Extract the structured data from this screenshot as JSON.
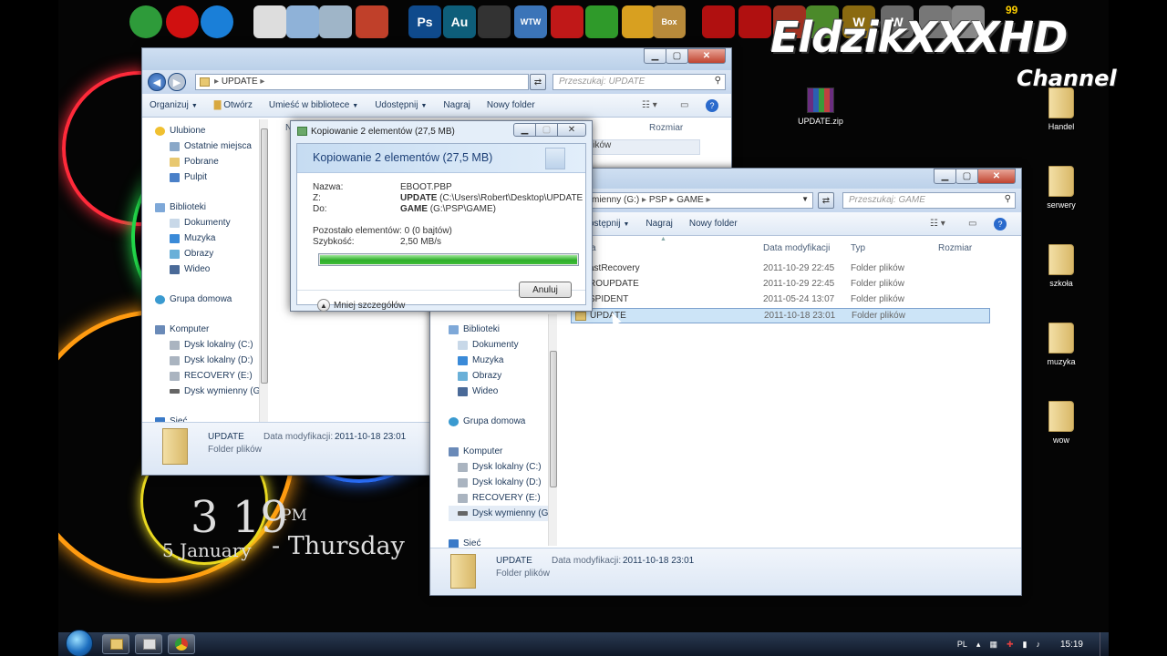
{
  "desktop": {
    "watermark_main": "EldzikXXXHD",
    "watermark_sub": "Channel",
    "clock": {
      "time": "3 19",
      "ampm": "PM",
      "date": "5 January",
      "day": "- Thursday"
    },
    "top_icons": [
      {
        "name": "chrome-icon",
        "color": "#2e9b3a"
      },
      {
        "name": "opera-icon",
        "color": "#d01010"
      },
      {
        "name": "ie-icon",
        "color": "#1a7fd8"
      },
      {
        "name": "document-icon",
        "color": "#dddddd"
      },
      {
        "name": "folder-icon",
        "color": "#8fb2d8"
      },
      {
        "name": "recycle-bin-icon",
        "color": "#9fb5c8"
      },
      {
        "name": "media-icon",
        "color": "#c0402a"
      },
      {
        "name": "photoshop-icon",
        "color": "#0f4a8c",
        "label": "Ps"
      },
      {
        "name": "audition-icon",
        "color": "#0e5e7a",
        "label": "Au"
      },
      {
        "name": "monitor-icon",
        "color": "#333333"
      },
      {
        "name": "wtw-icon",
        "color": "#3b74b8",
        "label": "WTW"
      },
      {
        "name": "game-icon",
        "color": "#c01818"
      },
      {
        "name": "utorrent-icon",
        "color": "#2f9a2a"
      },
      {
        "name": "windows-flag-icon",
        "color": "#d8a020"
      },
      {
        "name": "hamster-box-icon",
        "color": "#b88a3a",
        "label": "Box"
      },
      {
        "name": "racing-icon",
        "color": "#b01010"
      },
      {
        "name": "racing-2-icon",
        "color": "#b01010"
      },
      {
        "name": "game-3-icon",
        "color": "#a03020"
      },
      {
        "name": "minecraft-icon",
        "color": "#4b8a2a"
      },
      {
        "name": "warcraft-icon",
        "color": "#8a6a10",
        "label": "W"
      },
      {
        "name": "warcraft-2-icon",
        "color": "#6a6a6a",
        "label": "W"
      },
      {
        "name": "steam-icon",
        "color": "#777777"
      },
      {
        "name": "tool-icon",
        "color": "#888888"
      }
    ],
    "top_badge": "99",
    "icons": [
      {
        "label": "UPDATE.zip",
        "type": "zip"
      },
      {
        "label": "Handel",
        "type": "folder"
      },
      {
        "label": "serwery",
        "type": "folder"
      },
      {
        "label": "szkoła",
        "type": "folder"
      },
      {
        "label": "muzyka",
        "type": "folder"
      },
      {
        "label": "wow",
        "type": "folder"
      }
    ]
  },
  "explorer1": {
    "path": "UPDATE",
    "search_placeholder": "Przeszukaj: UPDATE",
    "toolbar": {
      "organize": "Organizuj",
      "open": "Otwórz",
      "library": "Umieść w bibliotece",
      "share": "Udostępnij",
      "burn": "Nagraj",
      "new_folder": "Nowy folder"
    },
    "col_size": "Rozmiar",
    "col_name_partial": "N",
    "type_partial": "lików",
    "nav": {
      "favorites": "Ulubione",
      "fav_items": [
        "Ostatnie miejsca",
        "Pobrane",
        "Pulpit"
      ],
      "libraries": "Biblioteki",
      "lib_items": [
        "Dokumenty",
        "Muzyka",
        "Obrazy",
        "Wideo"
      ],
      "homegroup": "Grupa domowa",
      "computer": "Komputer",
      "drives": [
        "Dysk lokalny (C:)",
        "Dysk lokalny (D:)",
        "RECOVERY (E:)",
        "Dysk wymienny (G:)"
      ],
      "network": "Sieć"
    },
    "details": {
      "name": "UPDATE",
      "mod_label": "Data modyfikacji:",
      "mod_value": "2011-10-18 23:01",
      "type": "Folder plików"
    }
  },
  "explorer2": {
    "path": [
      "mienny (G:)",
      "PSP",
      "GAME"
    ],
    "search_placeholder": "Przeszukaj: GAME",
    "toolbar": {
      "share": "ostępnij",
      "burn": "Nagraj",
      "new_folder": "Nowy folder"
    },
    "columns": {
      "name": "a",
      "date": "Data modyfikacji",
      "type": "Typ",
      "size": "Rozmiar"
    },
    "files": [
      {
        "name": "astRecovery",
        "date": "2011-10-29 22:45",
        "type": "Folder plików",
        "selected": false
      },
      {
        "name": "ROUPDATE",
        "date": "2011-10-29 22:45",
        "type": "Folder plików",
        "selected": false
      },
      {
        "name": "SPIDENT",
        "date": "2011-05-24 13:07",
        "type": "Folder plików",
        "selected": false
      },
      {
        "name": "UPDATE",
        "date": "2011-10-18 23:01",
        "type": "Folder plików",
        "selected": true
      }
    ],
    "nav": {
      "libraries": "Biblioteki",
      "lib_items": [
        "Dokumenty",
        "Muzyka",
        "Obrazy",
        "Wideo"
      ],
      "homegroup": "Grupa domowa",
      "computer": "Komputer",
      "drives": [
        "Dysk lokalny (C:)",
        "Dysk lokalny (D:)",
        "RECOVERY (E:)",
        "Dysk wymienny (G:)"
      ],
      "network": "Sieć"
    },
    "details": {
      "name": "UPDATE",
      "mod_label": "Data modyfikacji:",
      "mod_value": "2011-10-18 23:01",
      "type": "Folder plików"
    }
  },
  "copy_dialog": {
    "title": "Kopiowanie 2 elementów (27,5 MB)",
    "heading": "Kopiowanie 2 elementów (27,5 MB)",
    "name_label": "Nazwa:",
    "name_value": "EBOOT.PBP",
    "from_label": "Z:",
    "from_bold": "UPDATE",
    "from_rest": "(C:\\Users\\Robert\\Desktop\\UPDATE",
    "to_label": "Do:",
    "to_bold": "GAME",
    "to_rest": "(G:\\PSP\\GAME)",
    "remaining_label": "Pozostało elementów:",
    "remaining_value": "0 (0 bajtów)",
    "speed_label": "Szybkość:",
    "speed_value": "2,50 MB/s",
    "progress": 1.0,
    "less_details": "Mniej szczegółów",
    "cancel": "Anuluj"
  },
  "taskbar": {
    "language": "PL",
    "time": "15:19"
  }
}
